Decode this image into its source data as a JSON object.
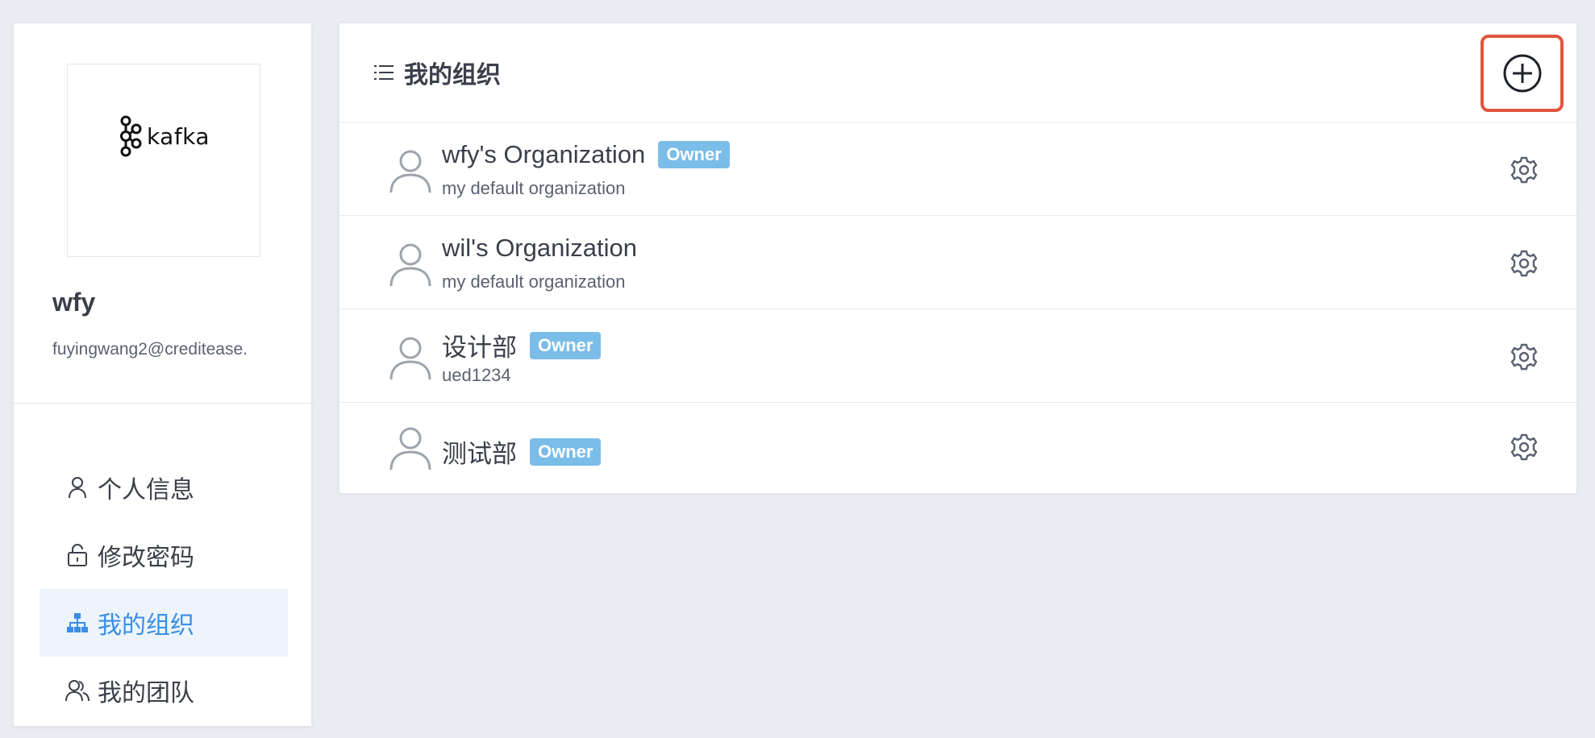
{
  "sidebar": {
    "logo_text": "kafka",
    "user_name": "wfy",
    "user_email": "fuyingwang2@creditease.",
    "menu": [
      {
        "label": "个人信息",
        "icon": "user-icon",
        "active": false
      },
      {
        "label": "修改密码",
        "icon": "lock-icon",
        "active": false
      },
      {
        "label": "我的组织",
        "icon": "org-chart-icon",
        "active": true
      },
      {
        "label": "我的团队",
        "icon": "team-icon",
        "active": false
      }
    ]
  },
  "main": {
    "title": "我的组织",
    "header_icon": "list-icon",
    "add_icon": "plus-circle-icon",
    "organizations": [
      {
        "name": "wfy's Organization",
        "badge": "Owner",
        "description": "my default organization"
      },
      {
        "name": "wil's Organization",
        "badge": "",
        "description": "my default organization"
      },
      {
        "name": "设计部",
        "badge": "Owner",
        "description": "ued1234"
      },
      {
        "name": "测试部",
        "badge": "Owner",
        "description": ""
      }
    ]
  },
  "colors": {
    "accent": "#3a8ee6",
    "active_bg": "#edf4fc",
    "badge": "#7bbde9",
    "highlight_border": "#e2553d",
    "page_bg": "#e9edf2"
  }
}
